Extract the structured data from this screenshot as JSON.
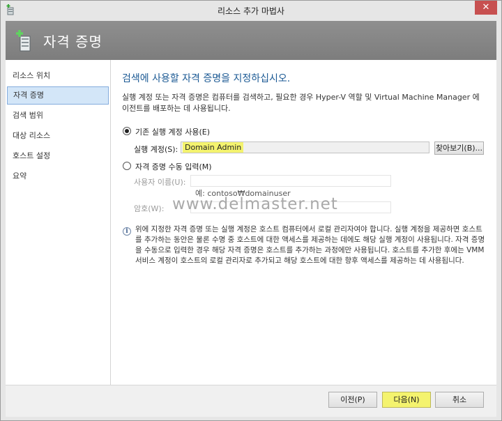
{
  "window": {
    "title": "리소스 추가 마법사",
    "close_symbol": "✕"
  },
  "banner": {
    "title": "자격 증명",
    "icon": "server-key-icon"
  },
  "sidebar": {
    "items": [
      {
        "label": "리소스 위치",
        "active": false
      },
      {
        "label": "자격 증명",
        "active": true
      },
      {
        "label": "검색 범위",
        "active": false
      },
      {
        "label": "대상 리소스",
        "active": false
      },
      {
        "label": "호스트 설정",
        "active": false
      },
      {
        "label": "요약",
        "active": false
      }
    ]
  },
  "main": {
    "heading": "검색에 사용할 자격 증명을 지정하십시오.",
    "description": "실행 계정 또는 자격 증명은 컴퓨터를 검색하고, 필요한 경우 Hyper-V 역할 및 Virtual Machine Manager 에이전트를 배포하는 데 사용됩니다.",
    "option_existing": {
      "label": "기존 실행 계정 사용(E)",
      "checked": true,
      "run_as_label": "실행 계정(S):",
      "run_as_value": "Domain Admin",
      "browse_label": "찾아보기(B)..."
    },
    "option_manual": {
      "label": "자격 증명 수동 입력(M)",
      "checked": false,
      "username_label": "사용자 이름(U):",
      "username_value": "",
      "username_example": "예: contoso₩domainuser",
      "password_label": "암호(W):",
      "password_value": ""
    },
    "watermark": "www.delmaster.net",
    "info_text": "위에 지정한 자격 증명 또는 실행 계정은 호스트 컴퓨터에서 로컬 관리자여야 합니다. 실행 계정을 제공하면 호스트를 추가하는 동안은 물론 수명 중 호스트에 대한 액세스를 제공하는 데에도 해당 실행 계정이 사용됩니다. 자격 증명을 수동으로 입력한 경우 해당 자격 증명은 호스트를 추가하는 과정에만 사용됩니다. 호스트를 추가한 후에는 VMM 서비스 계정이 호스트의 로컬 관리자로 추가되고 해당 호스트에 대한 향후 액세스를 제공하는 데 사용됩니다."
  },
  "footer": {
    "prev_label": "이전(P)",
    "next_label": "다음(N)",
    "cancel_label": "취소"
  },
  "colors": {
    "heading": "#1c5a94",
    "banner": "#858585",
    "highlight": "#f4f36e",
    "close_button": "#c75050",
    "active_item": "#d3e6f8"
  }
}
